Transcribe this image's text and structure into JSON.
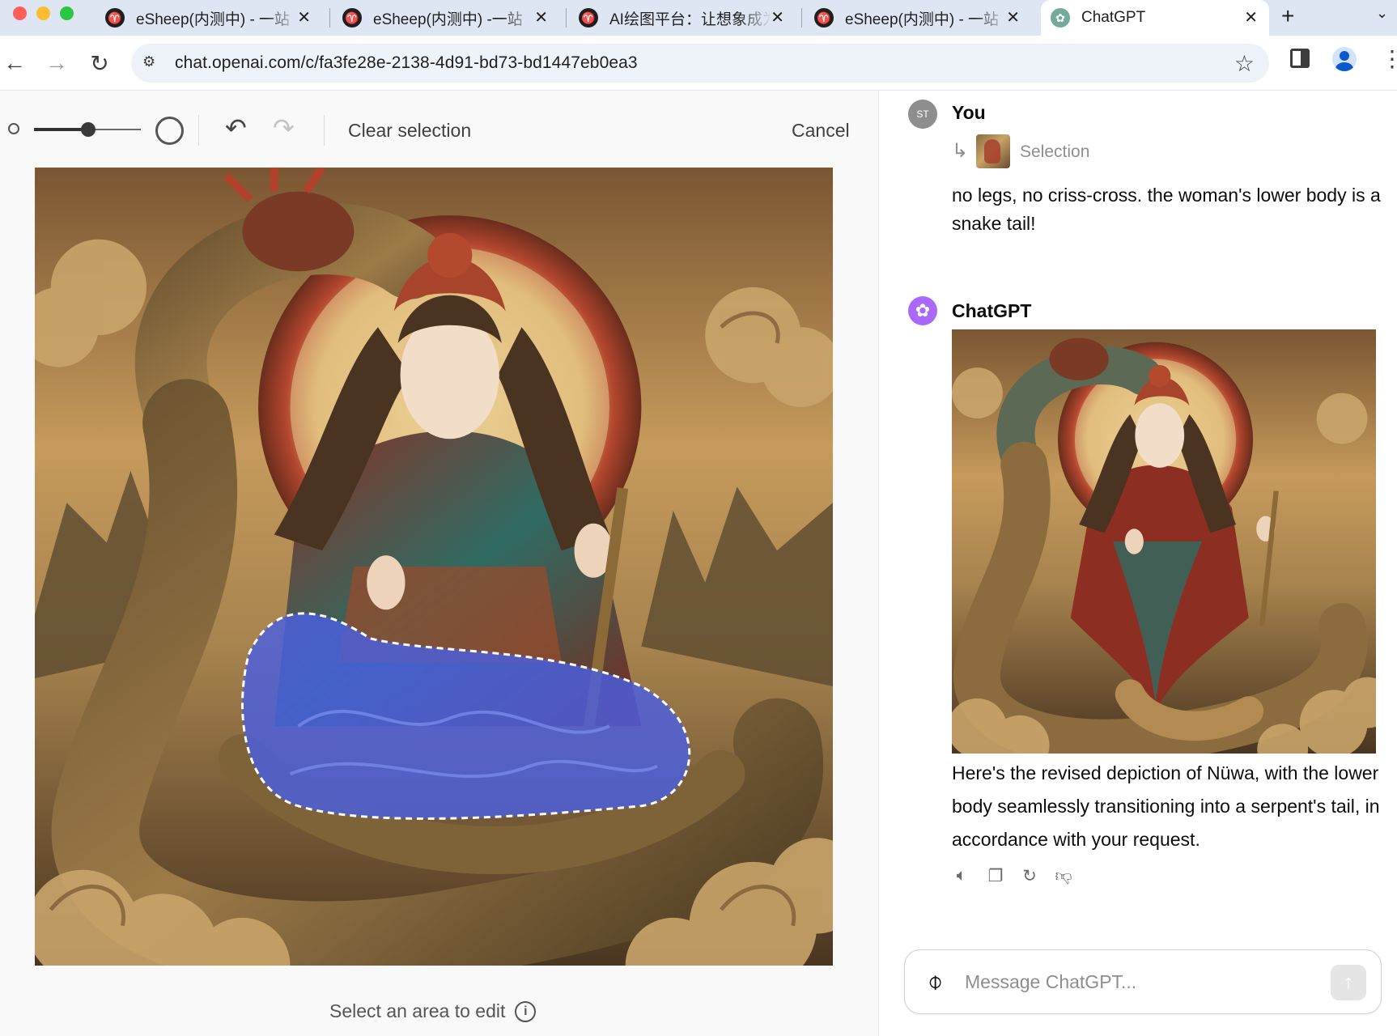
{
  "browser": {
    "tabs": [
      {
        "title": "eSheep(内测中) - 一站",
        "close": "✕"
      },
      {
        "title": "eSheep(内测中) -一站",
        "close": "✕"
      },
      {
        "title": "AI绘图平台：让想象成为",
        "close": "✕"
      },
      {
        "title": "eSheep(内测中) - 一站",
        "close": "✕"
      },
      {
        "title": "ChatGPT",
        "close": "✕",
        "active": true
      }
    ],
    "new_tab": "+",
    "tab_menu": "⌄",
    "url": "chat.openai.com/c/fa3fe28e-2138-4d91-bd73-bd1447eb0ea3"
  },
  "editor": {
    "clear_selection_label": "Clear selection",
    "cancel_label": "Cancel",
    "hint": "Select an area to edit",
    "brush_size": 0.5,
    "mask_color": "#4a5fe0"
  },
  "chat": {
    "user": {
      "avatar": "ST",
      "name": "You",
      "selection_label": "Selection",
      "message": "no legs, no criss-cross. the woman's lower body is a snake tail!"
    },
    "assistant": {
      "name": "ChatGPT",
      "message": "Here's the revised depiction of Nüwa, with the lower body seamlessly transitioning into a serpent's tail, in accordance with your request."
    },
    "actions": [
      "speaker-icon",
      "copy-icon",
      "regenerate-icon",
      "thumbs-down-icon"
    ],
    "composer_placeholder": "Message ChatGPT..."
  },
  "colors": {
    "accent_gpt": "#ab68ff",
    "tab_strip": "#dfe6f3"
  }
}
